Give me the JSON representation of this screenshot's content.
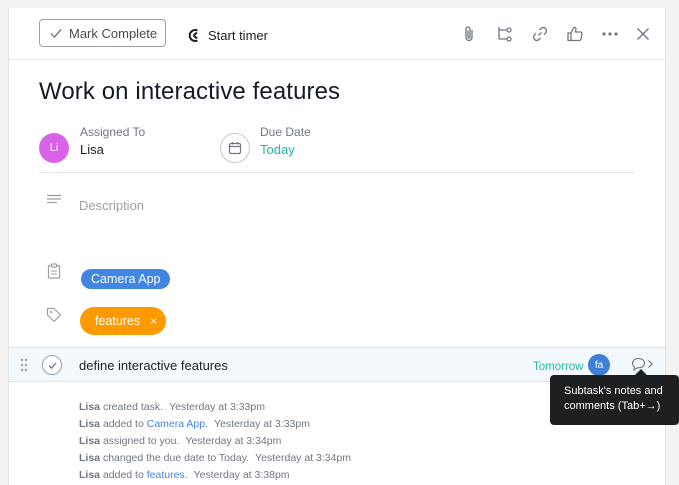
{
  "toolbar": {
    "mark_complete": "Mark Complete",
    "start_timer": "Start timer",
    "icons": [
      "paperclip-icon",
      "subtask-icon",
      "link-icon",
      "thumbs-up-icon",
      "more-icon",
      "close-icon"
    ]
  },
  "task": {
    "title": "Work on interactive features",
    "assigned_label": "Assigned To",
    "assignee": "Lisa",
    "assignee_initials": "Li",
    "due_label": "Due Date",
    "due_value": "Today",
    "description_placeholder": "Description",
    "project": "Camera App",
    "tag": "features",
    "tag_remove": "×"
  },
  "subtask": {
    "name": "define interactive features",
    "due": "Tomorrow",
    "assignee_initials": "fa"
  },
  "tooltip": {
    "text": "Subtask's notes and comments (Tab+→)"
  },
  "activity": [
    {
      "user": "Lisa",
      "text": "created task.",
      "time": "Yesterday at 3:33pm"
    },
    {
      "user": "Lisa",
      "text": "added to ",
      "link": "Camera App",
      "suffix": ".",
      "time": "Yesterday at 3:33pm"
    },
    {
      "user": "Lisa",
      "text": "assigned to you.",
      "time": "Yesterday at 3:34pm"
    },
    {
      "user": "Lisa",
      "text": "changed the due date to Today.",
      "time": "Yesterday at 3:34pm"
    },
    {
      "user": "Lisa",
      "text": "added to ",
      "link": "features",
      "suffix": ".",
      "time": "Yesterday at 3:38pm"
    }
  ],
  "colors": {
    "assignee_avatar": "#d863e8",
    "due_today": "#25b8a2",
    "project_pill": "#4186e0",
    "tag_pill": "#fd9a00",
    "subtask_avatar": "#3f7fd7"
  }
}
